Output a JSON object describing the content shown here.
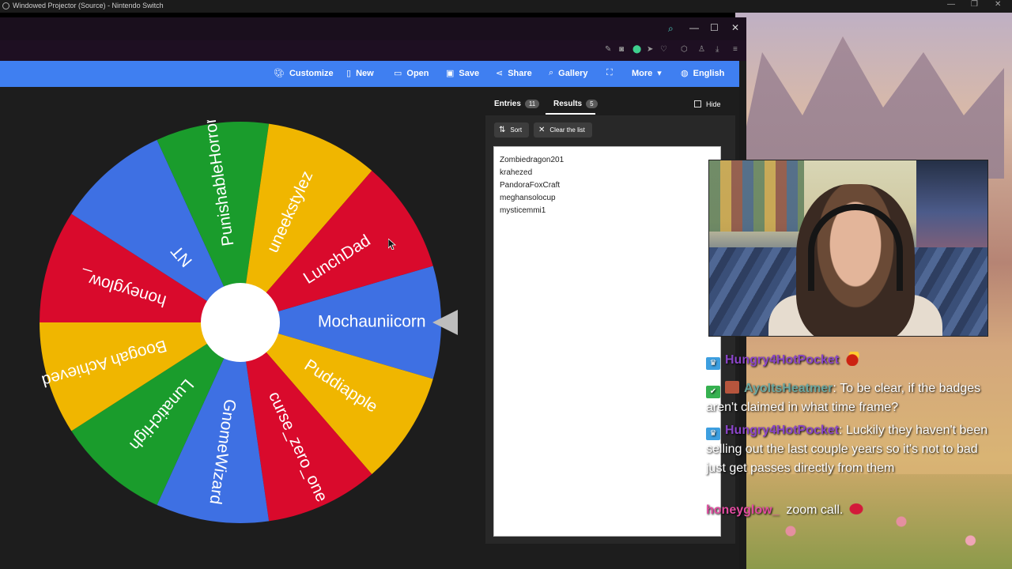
{
  "os_window": {
    "title": "Windowed Projector (Source) - Nintendo Switch",
    "minimize": "—",
    "restore": "❐",
    "close": "✕"
  },
  "browser": {
    "search_icon": "search-icon",
    "minimize": "—",
    "maximize": "☐",
    "close": "✕"
  },
  "app_nav": {
    "customize": "Customize",
    "new": "New",
    "open": "Open",
    "save": "Save",
    "share": "Share",
    "gallery": "Gallery",
    "more": "More",
    "language": "English"
  },
  "wheel": {
    "segments": [
      {
        "label": "Mochauniicorn",
        "color": "#3e70e3"
      },
      {
        "label": "Puddiapple",
        "color": "#f0b600"
      },
      {
        "label": "curse_zero_one",
        "color": "#d90a2c"
      },
      {
        "label": "GnomeWizard",
        "color": "#3e70e3"
      },
      {
        "label": "LunaticHigh",
        "color": "#1a9c2c"
      },
      {
        "label": "Boogah Achieved",
        "color": "#f0b600"
      },
      {
        "label": "honeyglow_",
        "color": "#d90a2c"
      },
      {
        "label": "NT",
        "color": "#3e70e3"
      },
      {
        "label": "PunishableHorror",
        "color": "#1a9c2c"
      },
      {
        "label": "uneekstylez",
        "color": "#f0b600"
      },
      {
        "label": "LunchDad",
        "color": "#d90a2c"
      }
    ]
  },
  "panel": {
    "tab_entries": "Entries",
    "entries_count": "11",
    "tab_results": "Results",
    "results_count": "5",
    "hide_label": "Hide",
    "sort_label": "Sort",
    "clear_label": "Clear the list",
    "results": [
      "Zombiedragon201",
      "krahezed",
      "PandoraFoxCraft",
      "meghansolocup",
      "mysticemmi1"
    ]
  },
  "chat": {
    "top_partial": "",
    "line1_user": "Hungry4HotPocket",
    "line2_user": "AyoItsHeatmer",
    "line2_sep": ":",
    "line2_text": "To be clear, if the badges aren't claimed in what time frame?",
    "line3_user": "Hungry4HotPocket",
    "line3_sep": ":",
    "line3_text": "Luckily they haven't been selling out the last couple years so it's not to bad just get passes directly from them",
    "line4_user": "honeyglow_",
    "line4_text": "zoom call."
  },
  "colors": {
    "app_blue": "#3f7ff1",
    "wheel_blue": "#3e70e3",
    "wheel_yellow": "#f0b600",
    "wheel_red": "#d90a2c",
    "wheel_green": "#1a9c2c"
  }
}
